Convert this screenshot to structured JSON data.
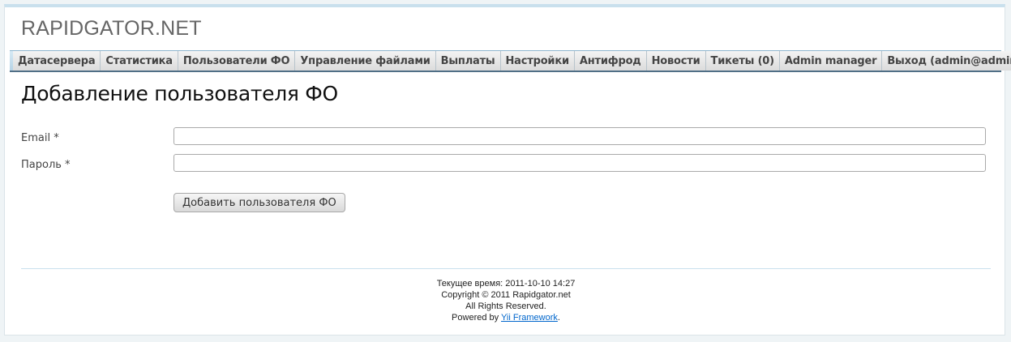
{
  "header": {
    "logo": "RAPIDGATOR.NET"
  },
  "menu": {
    "items": [
      "Датасервера",
      "Статистика",
      "Пользователи ФО",
      "Управление файлами",
      "Выплаты",
      "Настройки",
      "Антифрод",
      "Новости",
      "Тикеты (0)",
      "Admin manager",
      "Выход (admin@admin.com)"
    ]
  },
  "main": {
    "title": "Добавление пользователя ФО",
    "form": {
      "email_label": "Email *",
      "email_value": "",
      "password_label": "Пароль *",
      "password_value": "",
      "submit_label": "Добавить пользователя ФО"
    }
  },
  "footer": {
    "time_line": "Текущее время: 2011-10-10 14:27",
    "copyright": "Copyright © 2011 Rapidgator.net",
    "rights": "All Rights Reserved.",
    "powered_prefix": "Powered by ",
    "powered_link": "Yii Framework",
    "powered_suffix": "."
  },
  "colors": {
    "menu_gradient_top": "#d6e9f4",
    "menu_gradient_bottom": "#b6d3e6",
    "link": "#0066cc"
  }
}
